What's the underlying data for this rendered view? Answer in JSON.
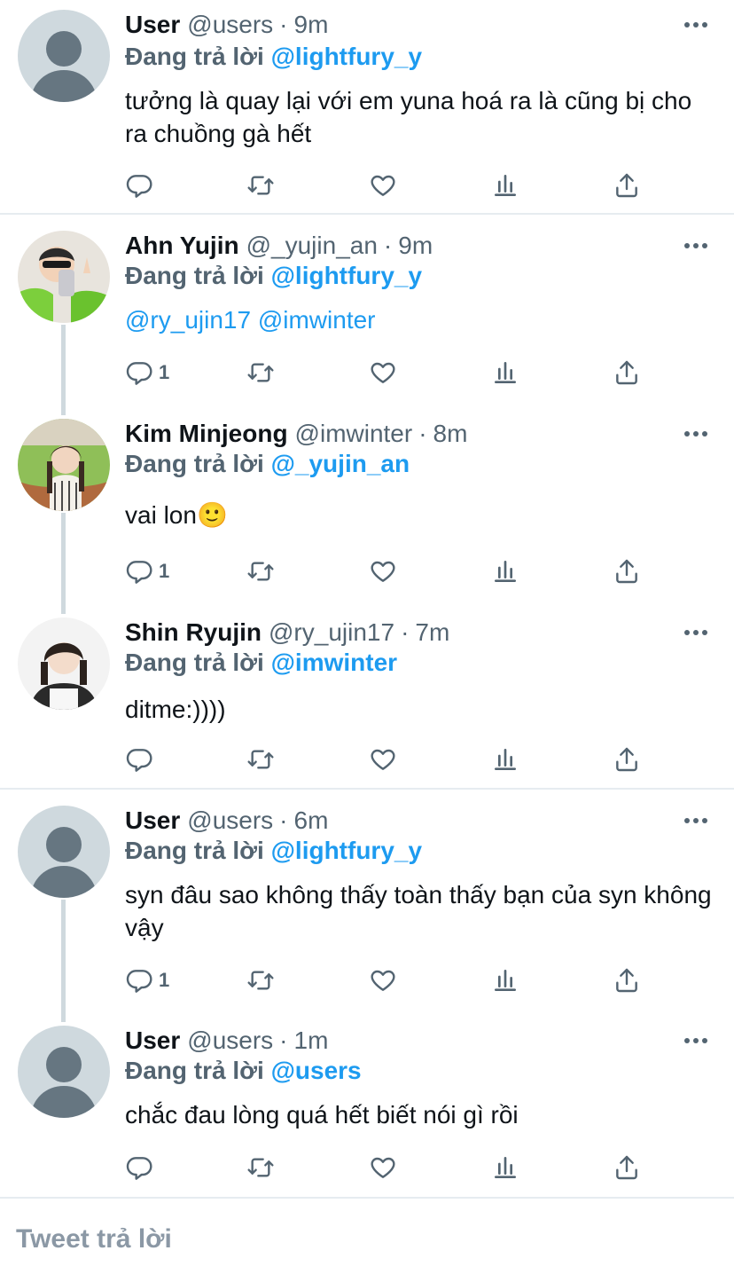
{
  "colors": {
    "link": "#1d9bf0",
    "secondary": "#536471",
    "divider": "#e6ecf0"
  },
  "icons": [
    "reply-icon",
    "retweet-icon",
    "like-icon",
    "views-icon",
    "share-icon",
    "more-icon"
  ],
  "tweets": [
    {
      "name": "User",
      "handle": "@users",
      "dot": "·",
      "time": "9m",
      "replying_prefix": "Đang trả lời",
      "replying_to": "@lightfury_y",
      "text": "tưởng là quay lại với em yuna hoá ra là cũng bị cho ra chuồng gà hết",
      "reply_count": ""
    },
    {
      "name": "Ahn Yujin",
      "handle": "@_yujin_an",
      "dot": "·",
      "time": "9m",
      "replying_prefix": "Đang trả lời",
      "replying_to": "@lightfury_y",
      "text": "@ry_ujin17 @imwinter",
      "reply_count": "1"
    },
    {
      "name": "Kim Minjeong",
      "handle": "@imwinter",
      "dot": "·",
      "time": "8m",
      "replying_prefix": "Đang trả lời",
      "replying_to": "@_yujin_an",
      "text": "vai lon🙂",
      "reply_count": "1"
    },
    {
      "name": "Shin Ryujin",
      "handle": "@ry_ujin17",
      "dot": "·",
      "time": "7m",
      "replying_prefix": "Đang trả lời",
      "replying_to": "@imwinter",
      "text": "ditme:))))",
      "reply_count": ""
    },
    {
      "name": "User",
      "handle": "@users",
      "dot": "·",
      "time": "6m",
      "replying_prefix": "Đang trả lời",
      "replying_to": "@lightfury_y",
      "text": "syn đâu sao không thấy toàn thấy bạn của syn không vậy",
      "reply_count": "1"
    },
    {
      "name": "User",
      "handle": "@users",
      "dot": "·",
      "time": "1m",
      "replying_prefix": "Đang trả lời",
      "replying_to": "@users",
      "text": "chắc đau lòng quá hết biết nói gì rồi",
      "reply_count": ""
    }
  ],
  "reply_bar": {
    "placeholder": "Tweet trả lời"
  }
}
